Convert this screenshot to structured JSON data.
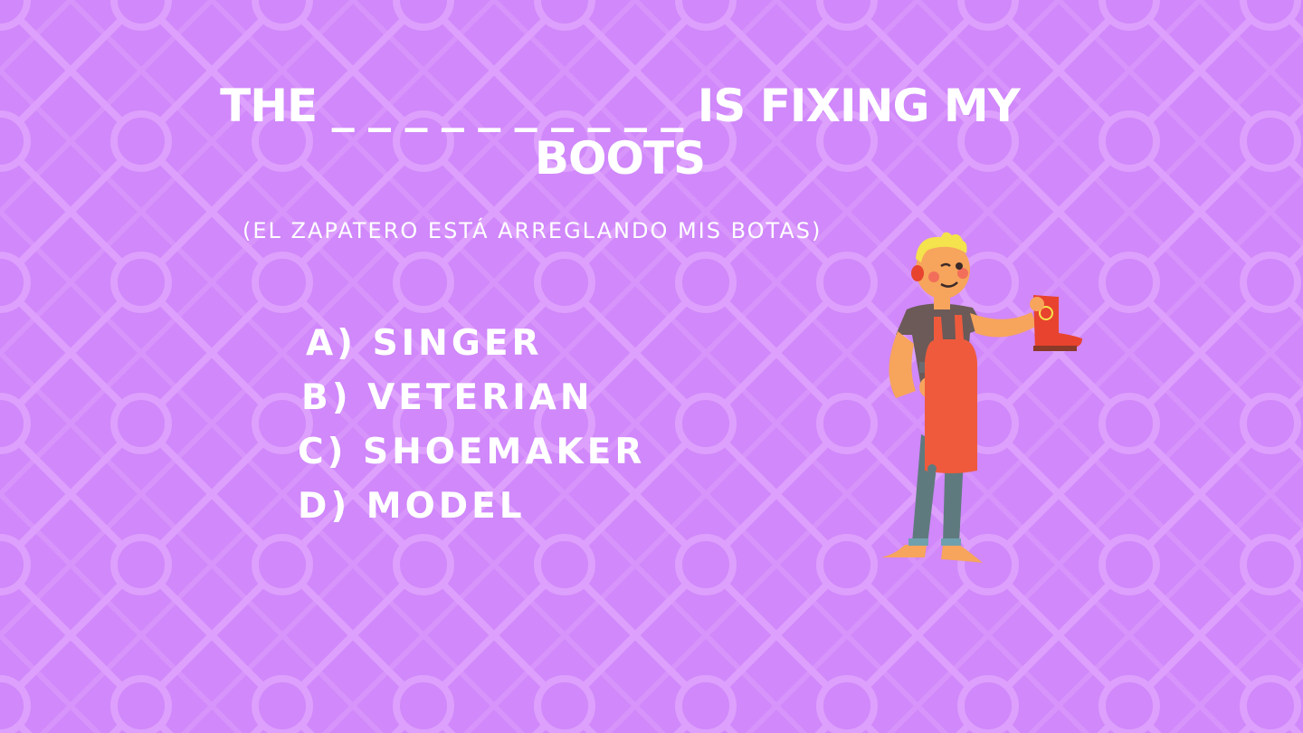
{
  "slide": {
    "question": "THE _ _ _ _ _ _ _ _ _ _  IS FIXING MY BOOTS",
    "translation": "(EL ZAPATERO ESTÁ ARREGLANDO MIS BOTAS)"
  },
  "options": [
    {
      "label": "A) SINGER"
    },
    {
      "label": "B) VETERIAN"
    },
    {
      "label": "C) SHOEMAKER"
    },
    {
      "label": "D) MODEL"
    }
  ],
  "colors": {
    "background": "#d088fa",
    "pattern": "#dda0fc",
    "text": "#ffffff",
    "apron": "#f05a3c",
    "boot": "#e8432e",
    "skin": "#f7a45c",
    "hair": "#f4e34c",
    "shirt": "#6b5a58",
    "pants": "#5f7a7e"
  },
  "illustration": {
    "icon": "shoemaker-holding-boot-illustration"
  }
}
